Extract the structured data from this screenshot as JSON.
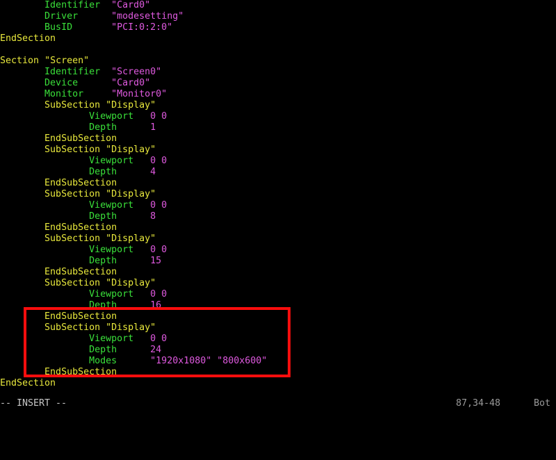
{
  "terminal": {
    "background": "#000000",
    "colors": {
      "keyword": "#e8e83c",
      "option": "#3ae03a",
      "value": "#e05ae0",
      "status": "#c8c8c8",
      "highlight": "#fc0d0d"
    }
  },
  "editor": {
    "lines": [
      {
        "indent": 8,
        "parts": [
          {
            "cls": "opt",
            "text": "Identifier"
          },
          {
            "cls": "pad",
            "text": "  "
          },
          {
            "cls": "val",
            "text": "\"Card0\""
          }
        ]
      },
      {
        "indent": 8,
        "parts": [
          {
            "cls": "opt",
            "text": "Driver"
          },
          {
            "cls": "pad",
            "text": "      "
          },
          {
            "cls": "val",
            "text": "\"modesetting\""
          }
        ]
      },
      {
        "indent": 8,
        "parts": [
          {
            "cls": "opt",
            "text": "BusID"
          },
          {
            "cls": "pad",
            "text": "       "
          },
          {
            "cls": "val",
            "text": "\"PCI:0:2:0\""
          }
        ]
      },
      {
        "indent": 0,
        "parts": [
          {
            "cls": "kw",
            "text": "EndSection"
          }
        ]
      },
      {
        "indent": 0,
        "parts": []
      },
      {
        "indent": 0,
        "parts": [
          {
            "cls": "kw",
            "text": "Section"
          },
          {
            "cls": "pad",
            "text": " "
          },
          {
            "cls": "kw",
            "text": "\"Screen\""
          }
        ]
      },
      {
        "indent": 8,
        "parts": [
          {
            "cls": "opt",
            "text": "Identifier"
          },
          {
            "cls": "pad",
            "text": "  "
          },
          {
            "cls": "val",
            "text": "\"Screen0\""
          }
        ]
      },
      {
        "indent": 8,
        "parts": [
          {
            "cls": "opt",
            "text": "Device"
          },
          {
            "cls": "pad",
            "text": "      "
          },
          {
            "cls": "val",
            "text": "\"Card0\""
          }
        ]
      },
      {
        "indent": 8,
        "parts": [
          {
            "cls": "opt",
            "text": "Monitor"
          },
          {
            "cls": "pad",
            "text": "     "
          },
          {
            "cls": "val",
            "text": "\"Monitor0\""
          }
        ]
      },
      {
        "indent": 8,
        "parts": [
          {
            "cls": "kw",
            "text": "SubSection"
          },
          {
            "cls": "pad",
            "text": " "
          },
          {
            "cls": "kw",
            "text": "\"Display\""
          }
        ]
      },
      {
        "indent": 16,
        "parts": [
          {
            "cls": "opt",
            "text": "Viewport"
          },
          {
            "cls": "pad",
            "text": "   "
          },
          {
            "cls": "val",
            "text": "0 0"
          }
        ]
      },
      {
        "indent": 16,
        "parts": [
          {
            "cls": "opt",
            "text": "Depth"
          },
          {
            "cls": "pad",
            "text": "      "
          },
          {
            "cls": "val",
            "text": "1"
          }
        ]
      },
      {
        "indent": 8,
        "parts": [
          {
            "cls": "kw",
            "text": "EndSubSection"
          }
        ]
      },
      {
        "indent": 8,
        "parts": [
          {
            "cls": "kw",
            "text": "SubSection"
          },
          {
            "cls": "pad",
            "text": " "
          },
          {
            "cls": "kw",
            "text": "\"Display\""
          }
        ]
      },
      {
        "indent": 16,
        "parts": [
          {
            "cls": "opt",
            "text": "Viewport"
          },
          {
            "cls": "pad",
            "text": "   "
          },
          {
            "cls": "val",
            "text": "0 0"
          }
        ]
      },
      {
        "indent": 16,
        "parts": [
          {
            "cls": "opt",
            "text": "Depth"
          },
          {
            "cls": "pad",
            "text": "      "
          },
          {
            "cls": "val",
            "text": "4"
          }
        ]
      },
      {
        "indent": 8,
        "parts": [
          {
            "cls": "kw",
            "text": "EndSubSection"
          }
        ]
      },
      {
        "indent": 8,
        "parts": [
          {
            "cls": "kw",
            "text": "SubSection"
          },
          {
            "cls": "pad",
            "text": " "
          },
          {
            "cls": "kw",
            "text": "\"Display\""
          }
        ]
      },
      {
        "indent": 16,
        "parts": [
          {
            "cls": "opt",
            "text": "Viewport"
          },
          {
            "cls": "pad",
            "text": "   "
          },
          {
            "cls": "val",
            "text": "0 0"
          }
        ]
      },
      {
        "indent": 16,
        "parts": [
          {
            "cls": "opt",
            "text": "Depth"
          },
          {
            "cls": "pad",
            "text": "      "
          },
          {
            "cls": "val",
            "text": "8"
          }
        ]
      },
      {
        "indent": 8,
        "parts": [
          {
            "cls": "kw",
            "text": "EndSubSection"
          }
        ]
      },
      {
        "indent": 8,
        "parts": [
          {
            "cls": "kw",
            "text": "SubSection"
          },
          {
            "cls": "pad",
            "text": " "
          },
          {
            "cls": "kw",
            "text": "\"Display\""
          }
        ]
      },
      {
        "indent": 16,
        "parts": [
          {
            "cls": "opt",
            "text": "Viewport"
          },
          {
            "cls": "pad",
            "text": "   "
          },
          {
            "cls": "val",
            "text": "0 0"
          }
        ]
      },
      {
        "indent": 16,
        "parts": [
          {
            "cls": "opt",
            "text": "Depth"
          },
          {
            "cls": "pad",
            "text": "      "
          },
          {
            "cls": "val",
            "text": "15"
          }
        ]
      },
      {
        "indent": 8,
        "parts": [
          {
            "cls": "kw",
            "text": "EndSubSection"
          }
        ]
      },
      {
        "indent": 8,
        "parts": [
          {
            "cls": "kw",
            "text": "SubSection"
          },
          {
            "cls": "pad",
            "text": " "
          },
          {
            "cls": "kw",
            "text": "\"Display\""
          }
        ]
      },
      {
        "indent": 16,
        "parts": [
          {
            "cls": "opt",
            "text": "Viewport"
          },
          {
            "cls": "pad",
            "text": "   "
          },
          {
            "cls": "val",
            "text": "0 0"
          }
        ]
      },
      {
        "indent": 16,
        "parts": [
          {
            "cls": "opt",
            "text": "Depth"
          },
          {
            "cls": "pad",
            "text": "      "
          },
          {
            "cls": "val",
            "text": "16"
          }
        ]
      },
      {
        "indent": 8,
        "parts": [
          {
            "cls": "kw",
            "text": "EndSubSection"
          }
        ]
      },
      {
        "indent": 8,
        "parts": [
          {
            "cls": "kw",
            "text": "SubSection"
          },
          {
            "cls": "pad",
            "text": " "
          },
          {
            "cls": "kw",
            "text": "\"Display\""
          }
        ]
      },
      {
        "indent": 16,
        "parts": [
          {
            "cls": "opt",
            "text": "Viewport"
          },
          {
            "cls": "pad",
            "text": "   "
          },
          {
            "cls": "val",
            "text": "0 0"
          }
        ]
      },
      {
        "indent": 16,
        "parts": [
          {
            "cls": "opt",
            "text": "Depth"
          },
          {
            "cls": "pad",
            "text": "      "
          },
          {
            "cls": "val",
            "text": "24"
          }
        ]
      },
      {
        "indent": 16,
        "parts": [
          {
            "cls": "opt",
            "text": "Modes"
          },
          {
            "cls": "pad",
            "text": "      "
          },
          {
            "cls": "val",
            "text": "\"1920x1080\" \"800x600\""
          }
        ]
      },
      {
        "indent": 8,
        "parts": [
          {
            "cls": "kw",
            "text": "EndSubSection"
          }
        ]
      },
      {
        "indent": 0,
        "parts": [
          {
            "cls": "kw",
            "text": "EndSection"
          }
        ]
      }
    ]
  },
  "highlight": {
    "label": "display-subsection-highlight",
    "color": "#fc0d0d"
  },
  "status": {
    "mode": "-- INSERT --",
    "ruler": "87,34-48",
    "scroll_position": "Bot"
  }
}
